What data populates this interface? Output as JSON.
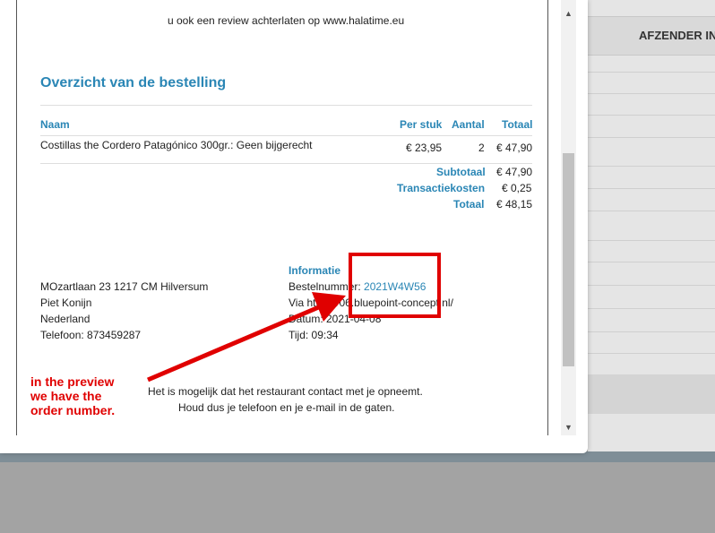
{
  "background": {
    "table_header": "AFZENDER IN"
  },
  "email": {
    "intro_line": "u ook een review achterlaten op www.halatime.eu",
    "section_title": "Overzicht van de bestelling",
    "table": {
      "headers": {
        "naam": "Naam",
        "per_stuk": "Per stuk",
        "aantal": "Aantal",
        "totaal": "Totaal"
      },
      "rows": [
        {
          "naam": "Costillas the Cordero Patagónico 300gr.: Geen bijgerecht",
          "per_stuk": "€ 23,95",
          "aantal": "2",
          "totaal": "€ 47,90"
        }
      ],
      "summary": [
        {
          "label": "Subtotaal",
          "value": "€ 47,90"
        },
        {
          "label": "Transactiekosten",
          "value": "€ 0,25"
        },
        {
          "label": "Totaal",
          "value": "€ 48,15"
        }
      ]
    },
    "address": [
      "MOzartlaan 23 1217 CM Hilversum",
      "Piet Konijn",
      "Nederland",
      "Telefoon: 873459287"
    ],
    "info": {
      "title": "Informatie",
      "order_label": "Bestelnummer:",
      "order_number": "2021W4W56",
      "via": "Via https://06.bluepoint-concept.nl/",
      "date": "Datum: 2021-04-08",
      "time": "Tijd: 09:34"
    },
    "footer": [
      "Het is mogelijk dat het restaurant contact met je opneemt.",
      "Houd dus je telefoon en je e-mail in de gaten."
    ]
  },
  "annotation": {
    "lines": [
      "in the preview",
      "we have the",
      "order number."
    ],
    "color": "#e00000"
  },
  "colors": {
    "accent": "#2a86b5",
    "overlay": "#a3a3a3"
  }
}
